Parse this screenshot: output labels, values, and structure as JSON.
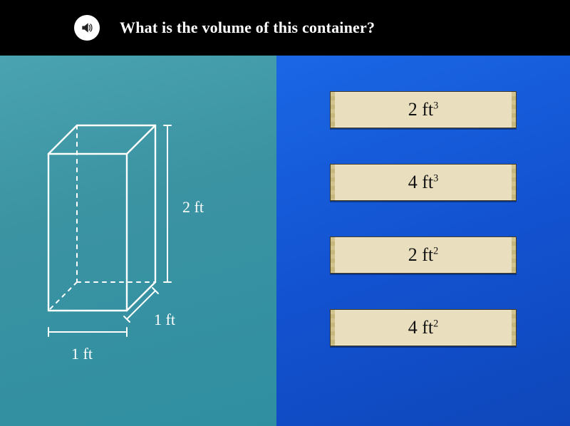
{
  "question": {
    "text": "What is the volume of this container?"
  },
  "icons": {
    "speaker": "speaker-icon"
  },
  "prism": {
    "dimensions": {
      "width_label": "1 ft",
      "depth_label": "1 ft",
      "height_label": "2 ft"
    }
  },
  "answers": [
    {
      "value_html": "2 ft<sup>3</sup>",
      "plain": "2 ft^3"
    },
    {
      "value_html": "4 ft<sup>3</sup>",
      "plain": "4 ft^3"
    },
    {
      "value_html": "2 ft<sup>2</sup>",
      "plain": "2 ft^2"
    },
    {
      "value_html": "4 ft<sup>2</sup>",
      "plain": "4 ft^2"
    }
  ],
  "colors": {
    "left_panel": "#3b93a2",
    "right_panel": "#1251cf",
    "answer_bg": "#e9dfbf"
  }
}
